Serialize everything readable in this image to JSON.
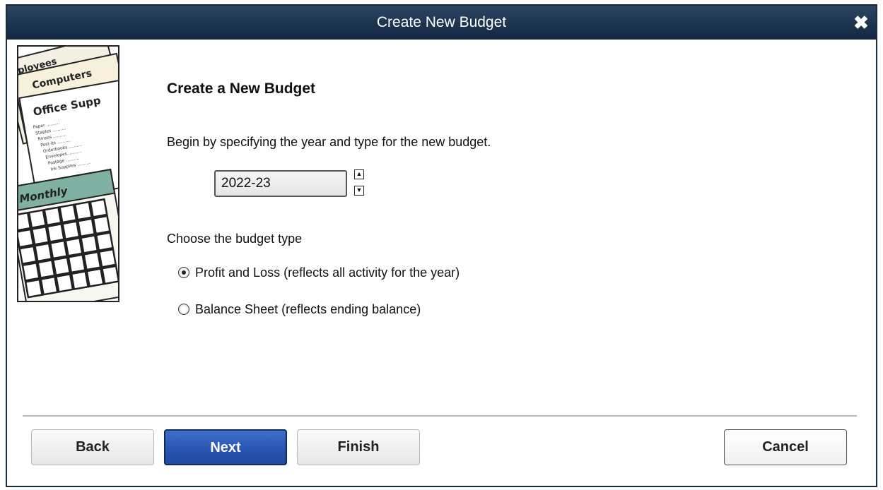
{
  "window": {
    "title": "Create New Budget",
    "close_icon": "close-icon"
  },
  "illustration": {
    "sheet_labels": [
      "mployees",
      "Computers",
      "Office Supp",
      "Monthly"
    ],
    "sheet_lines": [
      "Paper",
      "Staples",
      "Rinses",
      "Post-its",
      "Orderbooks",
      "Envelopes",
      "Postage",
      "Ink Supplies"
    ]
  },
  "content": {
    "heading": "Create a New Budget",
    "intro": "Begin by specifying the year and type for the new budget.",
    "year_value": "2022-23",
    "spin_up_icon": "chevron-up-icon",
    "spin_down_icon": "chevron-down-icon",
    "type_label": "Choose the budget type",
    "options": [
      {
        "label": "Profit and Loss (reflects all activity for the year)",
        "selected": true
      },
      {
        "label": "Balance Sheet (reflects ending balance)",
        "selected": false
      }
    ]
  },
  "buttons": {
    "back": "Back",
    "next": "Next",
    "finish": "Finish",
    "cancel": "Cancel"
  },
  "colors": {
    "titlebar": "#1d3550",
    "primary_button": "#2956b1",
    "calendar_green": "#7fb0a2"
  }
}
